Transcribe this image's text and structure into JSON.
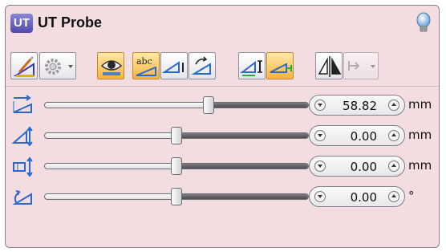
{
  "window": {
    "badge": "UT",
    "title": "UT Probe"
  },
  "toolbar": {
    "buttons": [
      {
        "icon": "edit-probe-icon",
        "state": "off"
      },
      {
        "icon": "settings-gear-icon",
        "state": "off",
        "dropdown": true
      },
      {
        "icon": "eye-view-icon",
        "state": "on"
      },
      {
        "icon": "abc-label-icon",
        "state": "on"
      },
      {
        "icon": "probe-angle-icon",
        "state": "off"
      },
      {
        "icon": "probe-rotate-icon",
        "state": "off"
      },
      {
        "icon": "probe-index-icon",
        "state": "off"
      },
      {
        "icon": "probe-flat-icon",
        "state": "on"
      },
      {
        "icon": "mirror-icon",
        "state": "off"
      },
      {
        "icon": "disabled-dropdown-icon",
        "state": "disabled",
        "dropdown": true
      }
    ]
  },
  "params": [
    {
      "icon": "offset-distance-icon",
      "value": "58.82",
      "unit": "mm",
      "level": 0.62
    },
    {
      "icon": "probe-skew-icon",
      "value": "0.00",
      "unit": "mm",
      "level": 0.5
    },
    {
      "icon": "probe-index-offset-icon",
      "value": "0.00",
      "unit": "mm",
      "level": 0.5
    },
    {
      "icon": "probe-angle-icon",
      "value": "0.00",
      "unit": "°",
      "level": 0.5
    }
  ],
  "colors": {
    "panel_bg": "#f3dde0",
    "active_button": "#f7b33d",
    "badge": "#5a55b5"
  }
}
